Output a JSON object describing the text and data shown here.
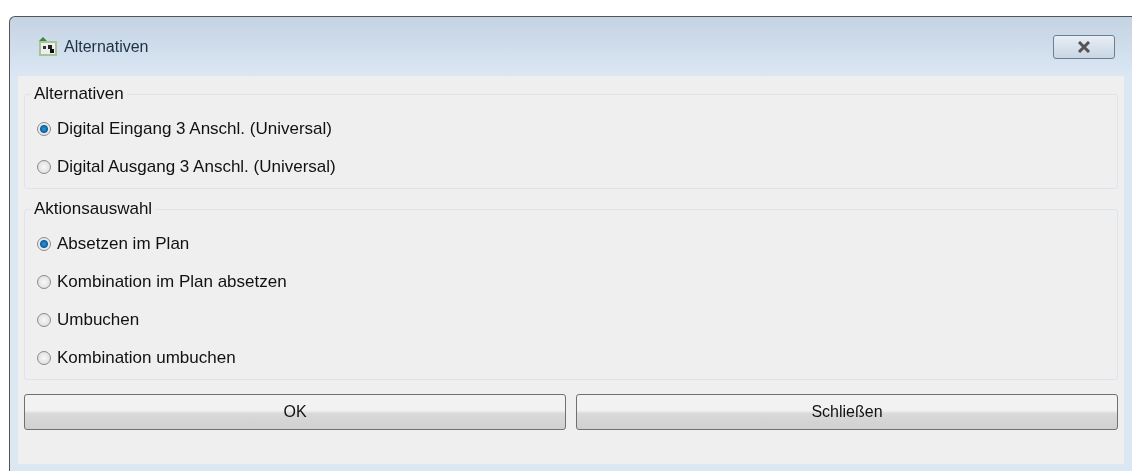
{
  "window": {
    "title": "Alternativen"
  },
  "groups": [
    {
      "title": "Alternativen",
      "options": [
        {
          "label": "Digital Eingang 3 Anschl. (Universal)",
          "selected": true
        },
        {
          "label": "Digital Ausgang 3 Anschl. (Universal)",
          "selected": false
        }
      ]
    },
    {
      "title": "Aktionsauswahl",
      "options": [
        {
          "label": "Absetzen im Plan",
          "selected": true
        },
        {
          "label": "Kombination im Plan absetzen",
          "selected": false
        },
        {
          "label": "Umbuchen",
          "selected": false
        },
        {
          "label": "Kombination umbuchen",
          "selected": false
        }
      ]
    }
  ],
  "buttons": [
    "OK",
    "Schließen"
  ]
}
